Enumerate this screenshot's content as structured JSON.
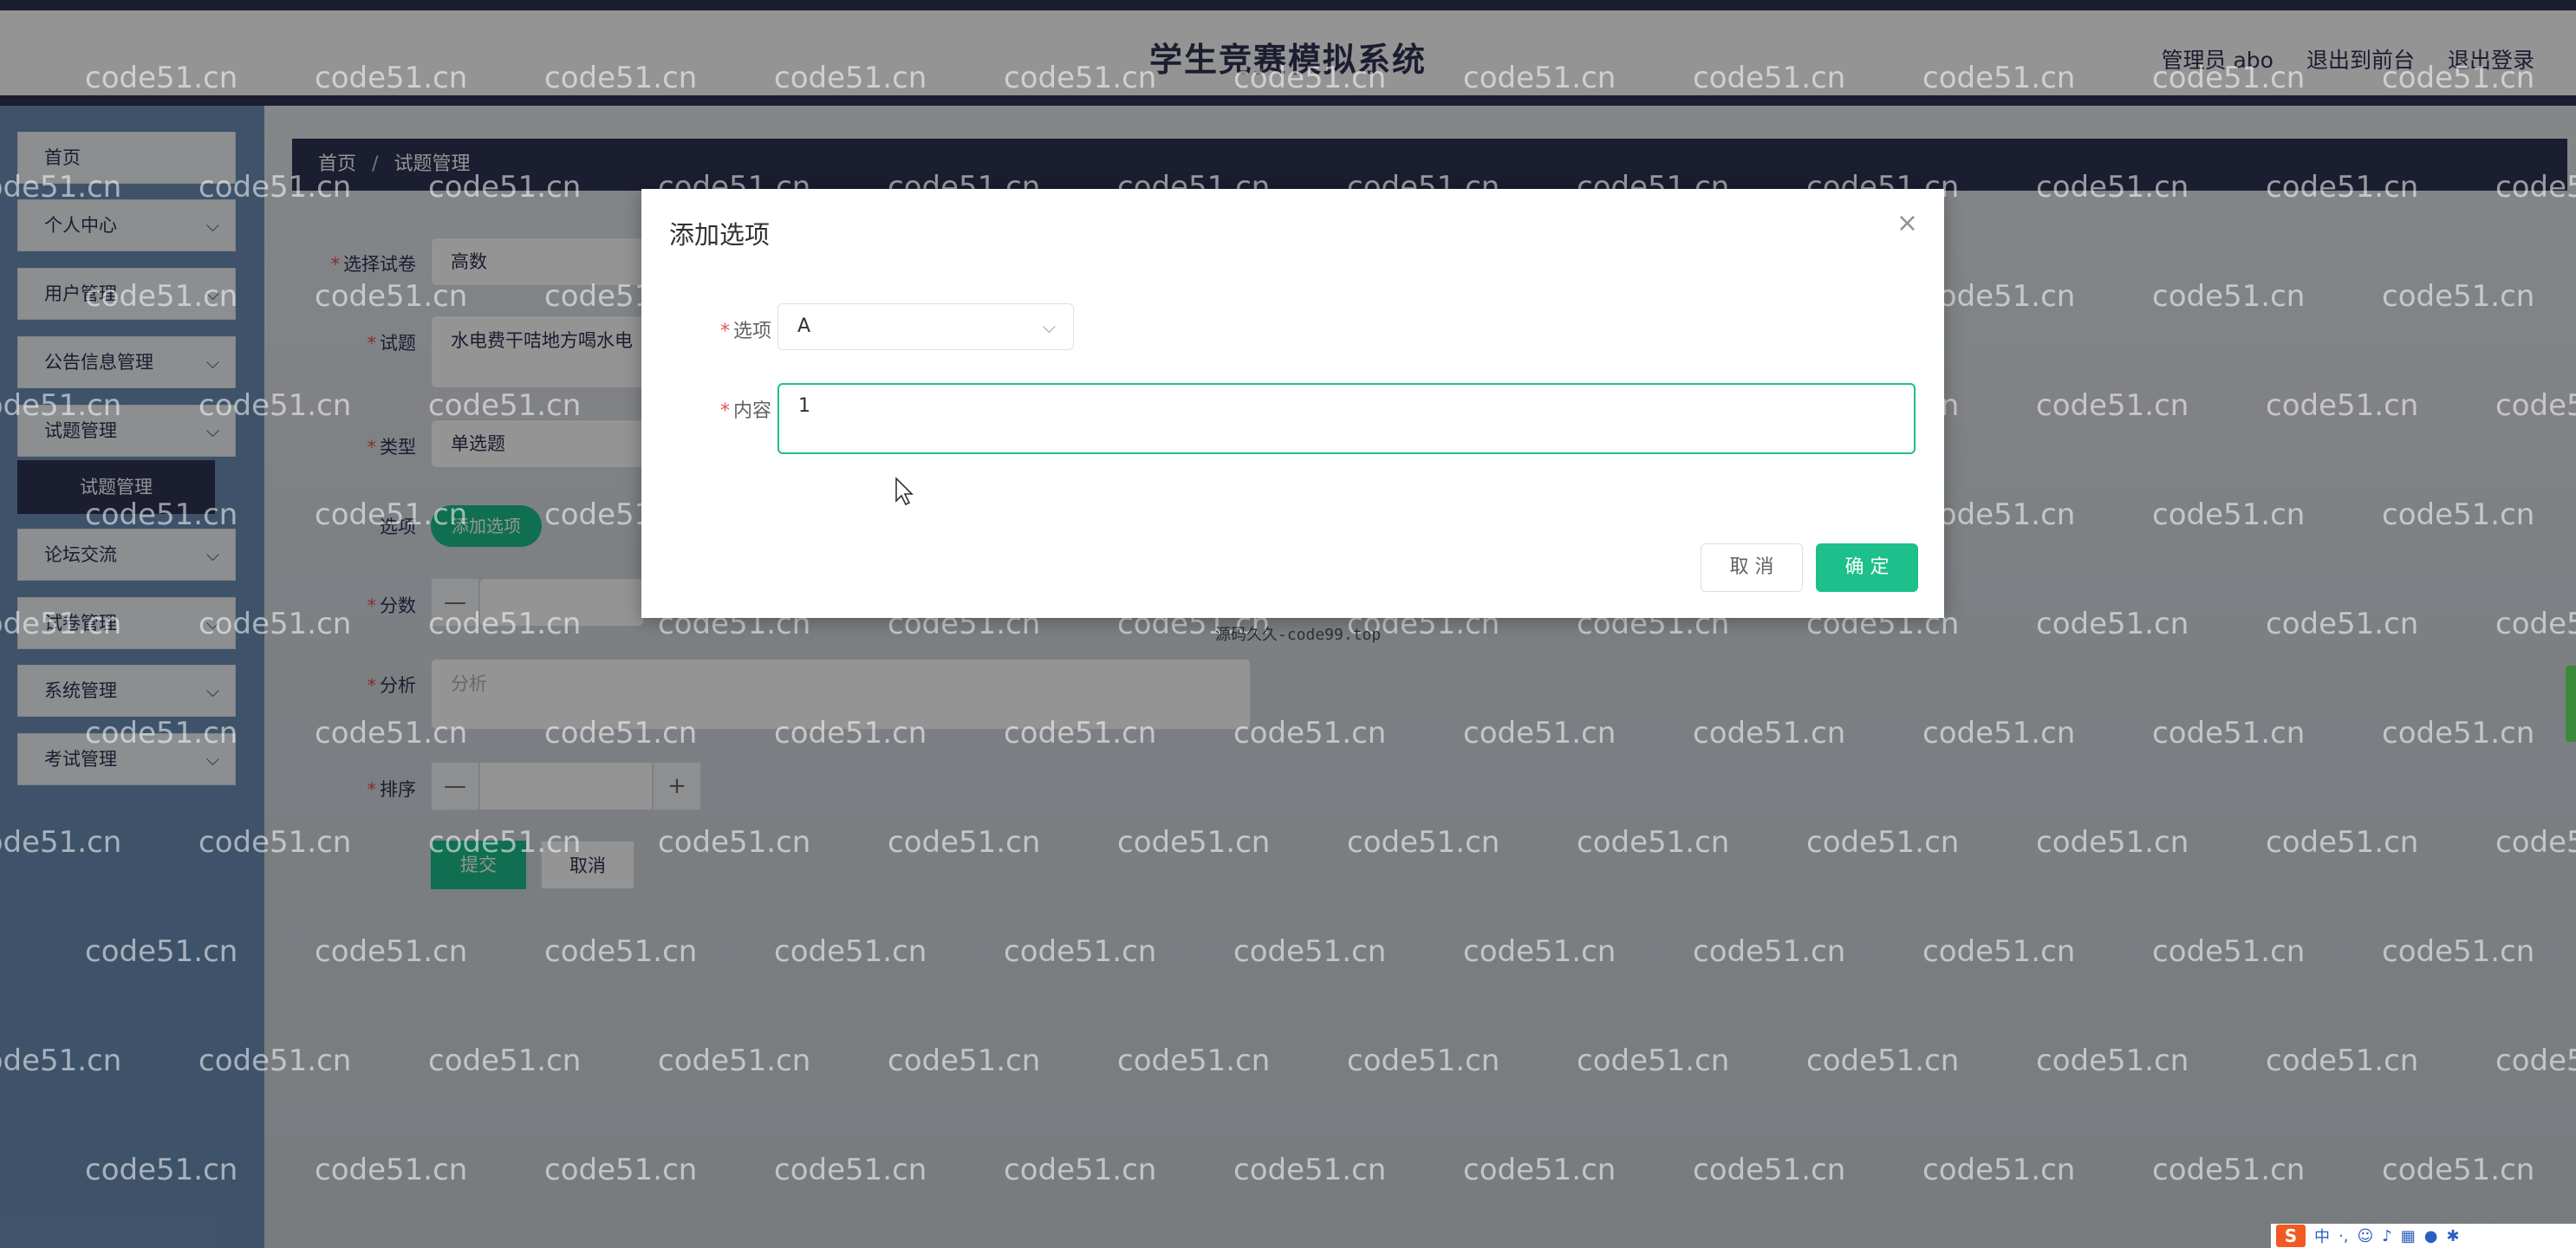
{
  "header": {
    "title": "学生竞赛模拟系统",
    "nav": [
      "管理员 abo",
      "退出到前台",
      "退出登录"
    ]
  },
  "sidebar": {
    "items": [
      {
        "label": "首页",
        "has_chevron": false
      },
      {
        "label": "个人中心",
        "has_chevron": true
      },
      {
        "label": "用户管理",
        "has_chevron": true
      },
      {
        "label": "公告信息管理",
        "has_chevron": true
      },
      {
        "label": "试题管理",
        "has_chevron": true
      },
      {
        "label": "论坛交流",
        "has_chevron": true
      },
      {
        "label": "试卷管理",
        "has_chevron": true
      },
      {
        "label": "系统管理",
        "has_chevron": true
      },
      {
        "label": "考试管理",
        "has_chevron": true
      }
    ],
    "active_sub": "试题管理"
  },
  "breadcrumb": {
    "home": "首页",
    "separator": "/",
    "current": "试题管理"
  },
  "form": {
    "paper": {
      "label": "选择试卷",
      "value": "高数"
    },
    "question": {
      "label": "试题",
      "value": "水电费干咭地方喝水电"
    },
    "type": {
      "label": "类型",
      "value": "单选题"
    },
    "options": {
      "label": "选项",
      "add_button": "添加选项"
    },
    "score": {
      "label": "分数",
      "minus": "—"
    },
    "analysis": {
      "label": "分析",
      "placeholder": "分析"
    },
    "order": {
      "label": "排序",
      "minus": "—",
      "plus": "+"
    },
    "submit": "提交",
    "cancel": "取消"
  },
  "dialog": {
    "title": "添加选项",
    "close": "×",
    "option_label": "选项",
    "option_value": "A",
    "content_label": "内容",
    "content_value": "1",
    "cancel": "取 消",
    "confirm": "确 定"
  },
  "watermark": {
    "text": "code51.cn",
    "center_text": "源码久久-code99.top"
  },
  "tray": {
    "icon_text": "S",
    "lang": "中"
  },
  "colors": {
    "primary": "#1dbf8b",
    "nav": "#2f3354",
    "required": "#e25252"
  }
}
